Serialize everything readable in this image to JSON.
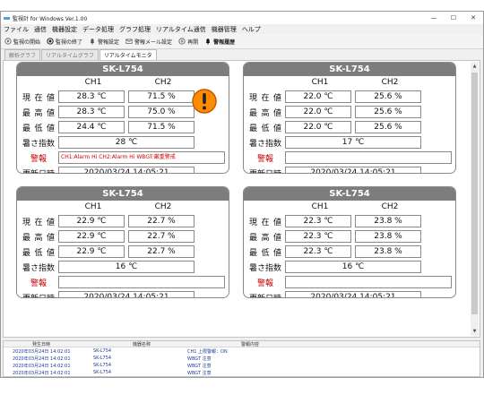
{
  "window": {
    "title": "監視計 for Windows Ver.1.00",
    "min": "—",
    "max": "☐",
    "close": "✕"
  },
  "menu": [
    "ファイル",
    "通信",
    "機器設定",
    "データ処理",
    "グラフ処理",
    "リアルタイム通信",
    "機器管理",
    "ヘルプ"
  ],
  "toolbar": [
    {
      "label": "監視の開始",
      "icon": "start-monitor-icon",
      "bold": false
    },
    {
      "label": "監視の終了",
      "icon": "stop-monitor-icon",
      "bold": false
    },
    {
      "label": "警報設定",
      "icon": "bell-icon",
      "bold": false
    },
    {
      "label": "警報メール設定",
      "icon": "mail-icon",
      "bold": false
    },
    {
      "label": "再開",
      "icon": "resume-icon",
      "bold": false
    },
    {
      "label": "警報履歴",
      "icon": "history-bell-icon",
      "bold": true
    }
  ],
  "tabs": [
    {
      "label": "解析グラフ",
      "active": false
    },
    {
      "label": "リアルタイムグラフ",
      "active": false
    },
    {
      "label": "リアルタイムモニタ",
      "active": true
    }
  ],
  "labels": {
    "current": "現在値",
    "max": "最高値",
    "min": "最低値",
    "heat_index": "暑さ指数",
    "alarm": "警報",
    "updated": "更新日時",
    "ch1": "CH1",
    "ch2": "CH2"
  },
  "cards": [
    {
      "device": "SK-L754",
      "current": [
        "28.3 ℃",
        "71.5 %"
      ],
      "max": [
        "28.3 ℃",
        "75.0 %"
      ],
      "min": [
        "24.4 ℃",
        "71.5 %"
      ],
      "heat_index": "28 ℃",
      "alarm": "CH1:Alarm Hi CH2:Alarm Hi WBGT:厳重警戒",
      "updated": "2020/03/24 14:05:21",
      "warning": true
    },
    {
      "device": "SK-L754",
      "current": [
        "22.0 ℃",
        "25.6 %"
      ],
      "max": [
        "22.0 ℃",
        "25.6 %"
      ],
      "min": [
        "22.0 ℃",
        "25.6 %"
      ],
      "heat_index": "17 ℃",
      "alarm": "",
      "updated": "2020/03/24 14:05:21",
      "warning": false
    },
    {
      "device": "SK-L754",
      "current": [
        "22.9 ℃",
        "22.7 %"
      ],
      "max": [
        "22.9 ℃",
        "22.7 %"
      ],
      "min": [
        "22.9 ℃",
        "22.7 %"
      ],
      "heat_index": "16 ℃",
      "alarm": "",
      "updated": "2020/03/24 14:05:21",
      "warning": false
    },
    {
      "device": "SK-L754",
      "current": [
        "22.3 ℃",
        "23.8 %"
      ],
      "max": [
        "22.3 ℃",
        "23.8 %"
      ],
      "min": [
        "22.3 ℃",
        "23.8 %"
      ],
      "heat_index": "16 ℃",
      "alarm": "",
      "updated": "2020/03/24 14:05:21",
      "warning": false
    }
  ],
  "log": {
    "headers": [
      "発生日時",
      "機器名称",
      "警報内容"
    ],
    "rows": [
      [
        "2020年03月24日 14:02:01",
        "SK-L754",
        "CH1 上限警報：ON"
      ],
      [
        "2020年03月24日 14:02:01",
        "SK-L754",
        "WBGT 注意"
      ],
      [
        "2020年03月24日 14:02:01",
        "SK-L754",
        "WBGT 注意"
      ],
      [
        "2020年03月24日 14:02:01",
        "SK-L754",
        "WBGT 注意"
      ]
    ]
  },
  "colors": {
    "card_header": "#7d7d7d",
    "alarm_text": "#d00000",
    "warning_icon": "#ff8c00",
    "log_text": "#1c3d99"
  }
}
